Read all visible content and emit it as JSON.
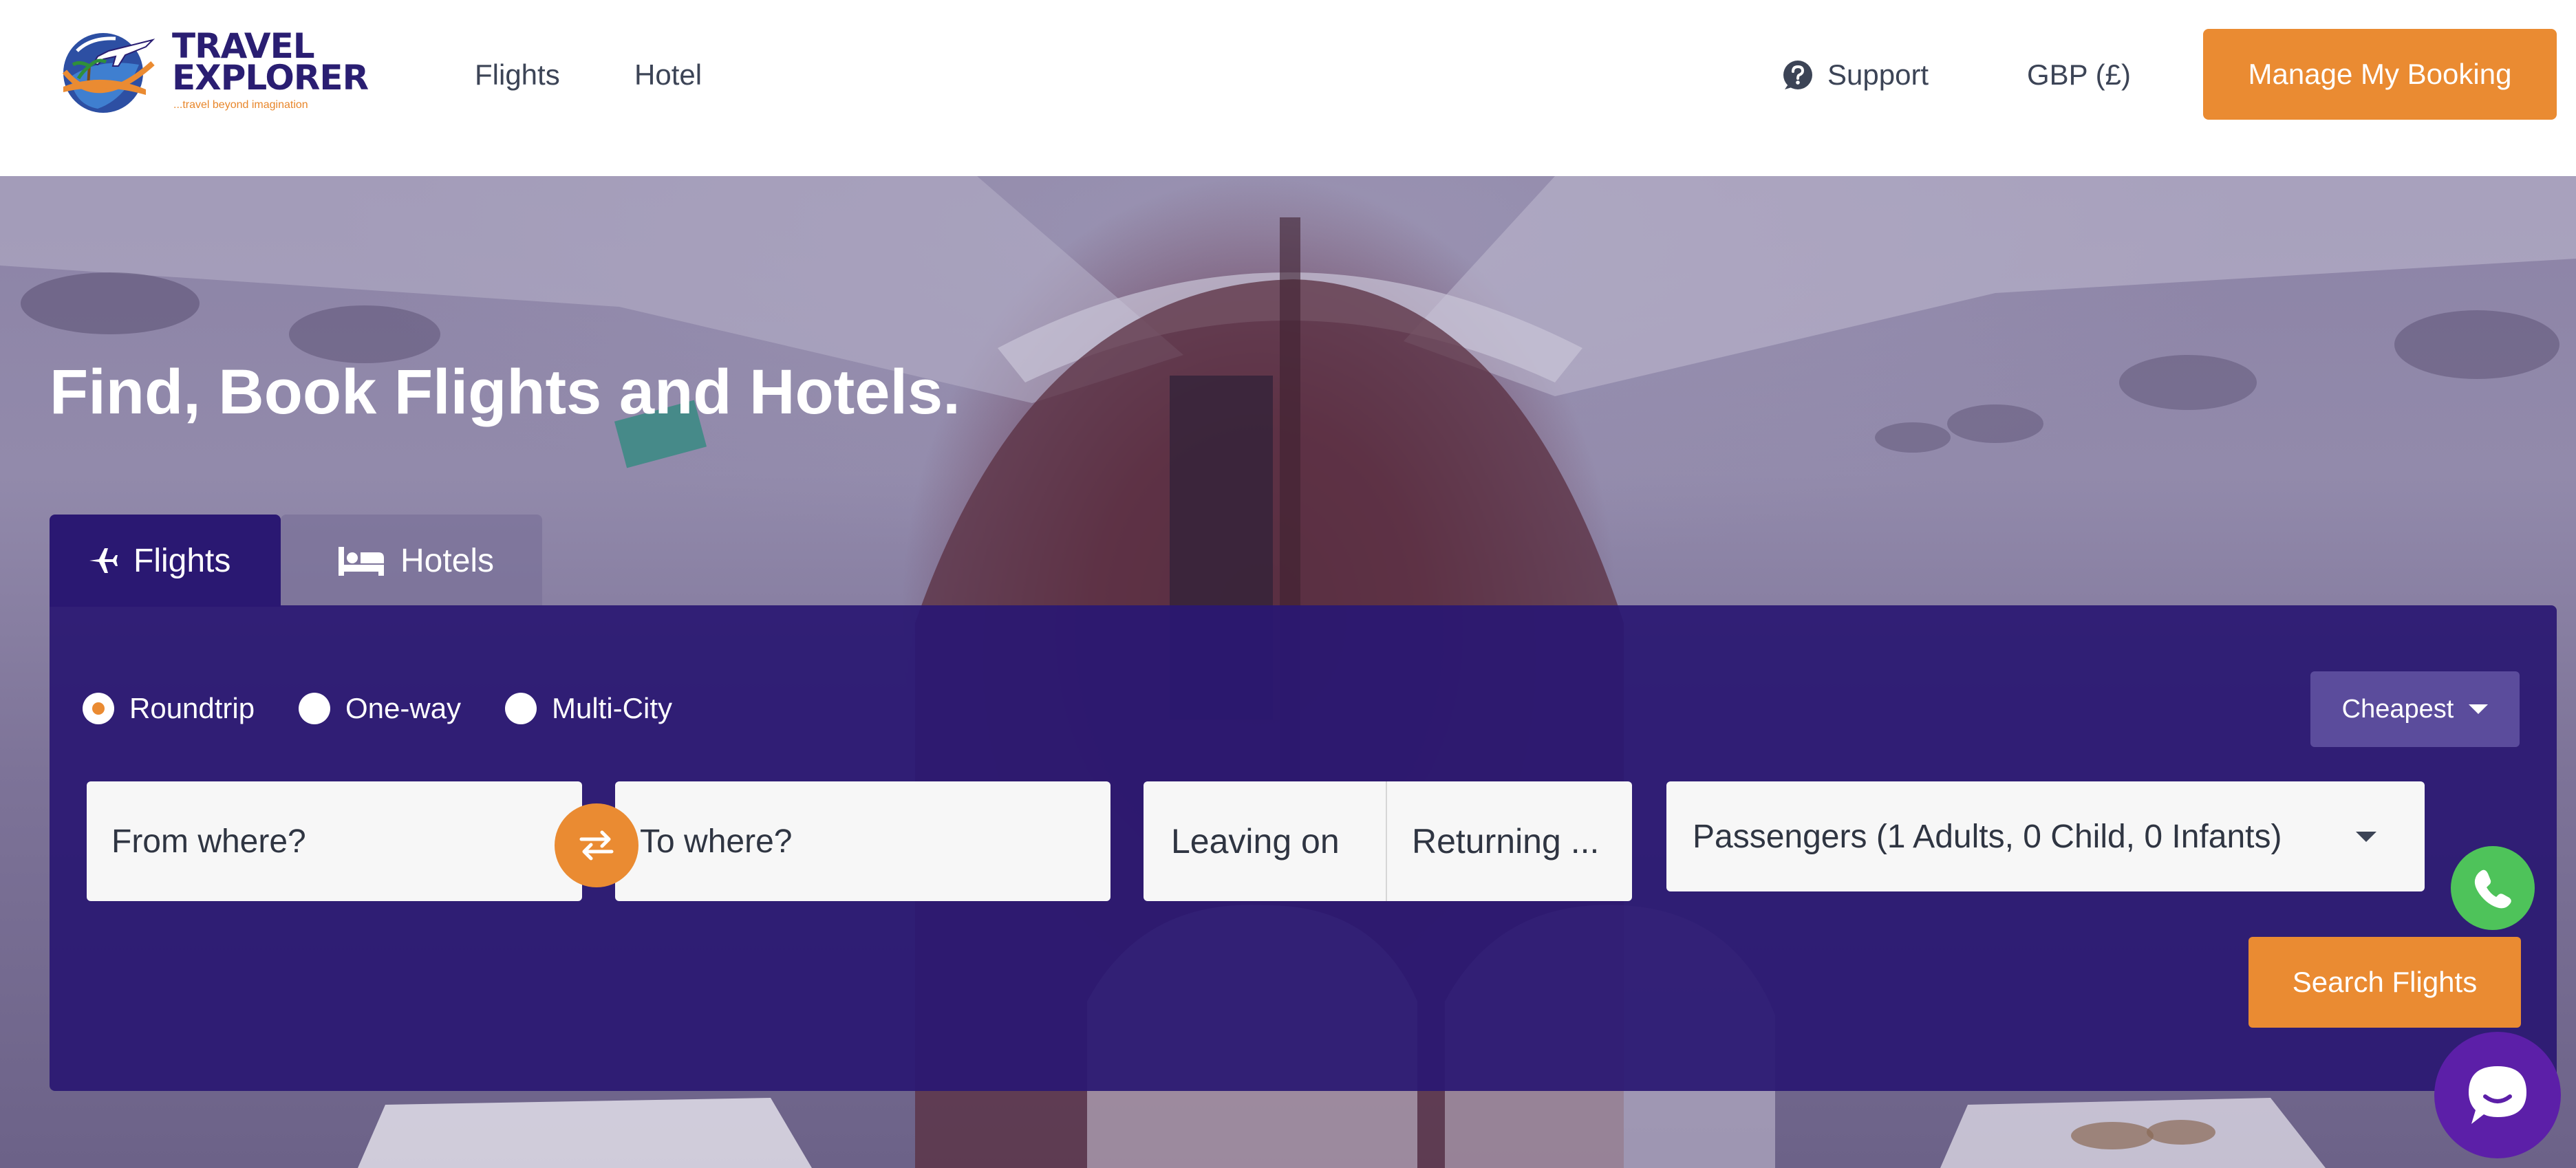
{
  "header": {
    "logo": {
      "line1": "TRAVEL",
      "line2": "EXPLORER",
      "tagline": "...travel beyond imagination"
    },
    "nav": [
      {
        "label": "Flights"
      },
      {
        "label": "Hotel"
      }
    ],
    "support_label": "Support",
    "currency_label": "GBP (£)",
    "manage_booking_label": "Manage My Booking"
  },
  "hero": {
    "title": "Find, Book Flights and Hotels."
  },
  "tabs": [
    {
      "label": "Flights",
      "icon": "plane-icon",
      "active": true
    },
    {
      "label": "Hotels",
      "icon": "bed-icon",
      "active": false
    }
  ],
  "search": {
    "trip_types": [
      {
        "label": "Roundtrip",
        "selected": true
      },
      {
        "label": "One-way",
        "selected": false
      },
      {
        "label": "Multi-City",
        "selected": false
      }
    ],
    "sort_label": "Cheapest",
    "from_placeholder": "From where?",
    "to_placeholder": "To where?",
    "leaving_placeholder": "Leaving on",
    "returning_placeholder": "Returning ...",
    "passengers_value": "Passengers (1 Adults, 0 Child, 0 Infants)",
    "search_button_label": "Search Flights"
  },
  "colors": {
    "brand_navy": "#2a1872",
    "accent_orange": "#ea8b32",
    "whatsapp_green": "#4ec35a",
    "chat_purple": "#5c1fa8"
  }
}
